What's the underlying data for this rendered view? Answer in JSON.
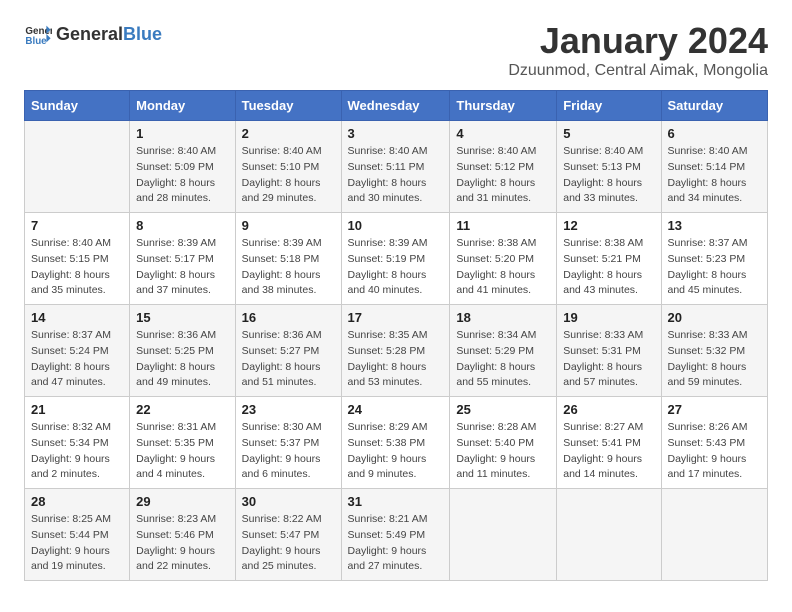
{
  "header": {
    "logo_general": "General",
    "logo_blue": "Blue",
    "month_title": "January 2024",
    "subtitle": "Dzuunmod, Central Aimak, Mongolia"
  },
  "days_of_week": [
    "Sunday",
    "Monday",
    "Tuesday",
    "Wednesday",
    "Thursday",
    "Friday",
    "Saturday"
  ],
  "weeks": [
    [
      {
        "day": "",
        "info": ""
      },
      {
        "day": "1",
        "info": "Sunrise: 8:40 AM\nSunset: 5:09 PM\nDaylight: 8 hours\nand 28 minutes."
      },
      {
        "day": "2",
        "info": "Sunrise: 8:40 AM\nSunset: 5:10 PM\nDaylight: 8 hours\nand 29 minutes."
      },
      {
        "day": "3",
        "info": "Sunrise: 8:40 AM\nSunset: 5:11 PM\nDaylight: 8 hours\nand 30 minutes."
      },
      {
        "day": "4",
        "info": "Sunrise: 8:40 AM\nSunset: 5:12 PM\nDaylight: 8 hours\nand 31 minutes."
      },
      {
        "day": "5",
        "info": "Sunrise: 8:40 AM\nSunset: 5:13 PM\nDaylight: 8 hours\nand 33 minutes."
      },
      {
        "day": "6",
        "info": "Sunrise: 8:40 AM\nSunset: 5:14 PM\nDaylight: 8 hours\nand 34 minutes."
      }
    ],
    [
      {
        "day": "7",
        "info": "Daylight: 8 hours\nand 35 minutes."
      },
      {
        "day": "8",
        "info": "Sunrise: 8:39 AM\nSunset: 5:17 PM\nDaylight: 8 hours\nand 37 minutes."
      },
      {
        "day": "9",
        "info": "Sunrise: 8:39 AM\nSunset: 5:18 PM\nDaylight: 8 hours\nand 38 minutes."
      },
      {
        "day": "10",
        "info": "Sunrise: 8:39 AM\nSunset: 5:19 PM\nDaylight: 8 hours\nand 40 minutes."
      },
      {
        "day": "11",
        "info": "Sunrise: 8:38 AM\nSunset: 5:20 PM\nDaylight: 8 hours\nand 41 minutes."
      },
      {
        "day": "12",
        "info": "Sunrise: 8:38 AM\nSunset: 5:21 PM\nDaylight: 8 hours\nand 43 minutes."
      },
      {
        "day": "13",
        "info": "Sunrise: 8:37 AM\nSunset: 5:23 PM\nDaylight: 8 hours\nand 45 minutes."
      }
    ],
    [
      {
        "day": "14",
        "info": "Sunrise: 8:37 AM\nSunset: 5:24 PM\nDaylight: 8 hours\nand 47 minutes."
      },
      {
        "day": "15",
        "info": "Sunrise: 8:36 AM\nSunset: 5:25 PM\nDaylight: 8 hours\nand 49 minutes."
      },
      {
        "day": "16",
        "info": "Sunrise: 8:36 AM\nSunset: 5:27 PM\nDaylight: 8 hours\nand 51 minutes."
      },
      {
        "day": "17",
        "info": "Sunrise: 8:35 AM\nSunset: 5:28 PM\nDaylight: 8 hours\nand 53 minutes."
      },
      {
        "day": "18",
        "info": "Sunrise: 8:34 AM\nSunset: 5:29 PM\nDaylight: 8 hours\nand 55 minutes."
      },
      {
        "day": "19",
        "info": "Sunrise: 8:33 AM\nSunset: 5:31 PM\nDaylight: 8 hours\nand 57 minutes."
      },
      {
        "day": "20",
        "info": "Sunrise: 8:33 AM\nSunset: 5:32 PM\nDaylight: 8 hours\nand 59 minutes."
      }
    ],
    [
      {
        "day": "21",
        "info": "Sunrise: 8:32 AM\nSunset: 5:34 PM\nDaylight: 9 hours\nand 2 minutes."
      },
      {
        "day": "22",
        "info": "Sunrise: 8:31 AM\nSunset: 5:35 PM\nDaylight: 9 hours\nand 4 minutes."
      },
      {
        "day": "23",
        "info": "Sunrise: 8:30 AM\nSunset: 5:37 PM\nDaylight: 9 hours\nand 6 minutes."
      },
      {
        "day": "24",
        "info": "Sunrise: 8:29 AM\nSunset: 5:38 PM\nDaylight: 9 hours\nand 9 minutes."
      },
      {
        "day": "25",
        "info": "Sunrise: 8:28 AM\nSunset: 5:40 PM\nDaylight: 9 hours\nand 11 minutes."
      },
      {
        "day": "26",
        "info": "Sunrise: 8:27 AM\nSunset: 5:41 PM\nDaylight: 9 hours\nand 14 minutes."
      },
      {
        "day": "27",
        "info": "Sunrise: 8:26 AM\nSunset: 5:43 PM\nDaylight: 9 hours\nand 17 minutes."
      }
    ],
    [
      {
        "day": "28",
        "info": "Sunrise: 8:25 AM\nSunset: 5:44 PM\nDaylight: 9 hours\nand 19 minutes."
      },
      {
        "day": "29",
        "info": "Sunrise: 8:23 AM\nSunset: 5:46 PM\nDaylight: 9 hours\nand 22 minutes."
      },
      {
        "day": "30",
        "info": "Sunrise: 8:22 AM\nSunset: 5:47 PM\nDaylight: 9 hours\nand 25 minutes."
      },
      {
        "day": "31",
        "info": "Sunrise: 8:21 AM\nSunset: 5:49 PM\nDaylight: 9 hours\nand 27 minutes."
      },
      {
        "day": "",
        "info": ""
      },
      {
        "day": "",
        "info": ""
      },
      {
        "day": "",
        "info": ""
      }
    ]
  ]
}
